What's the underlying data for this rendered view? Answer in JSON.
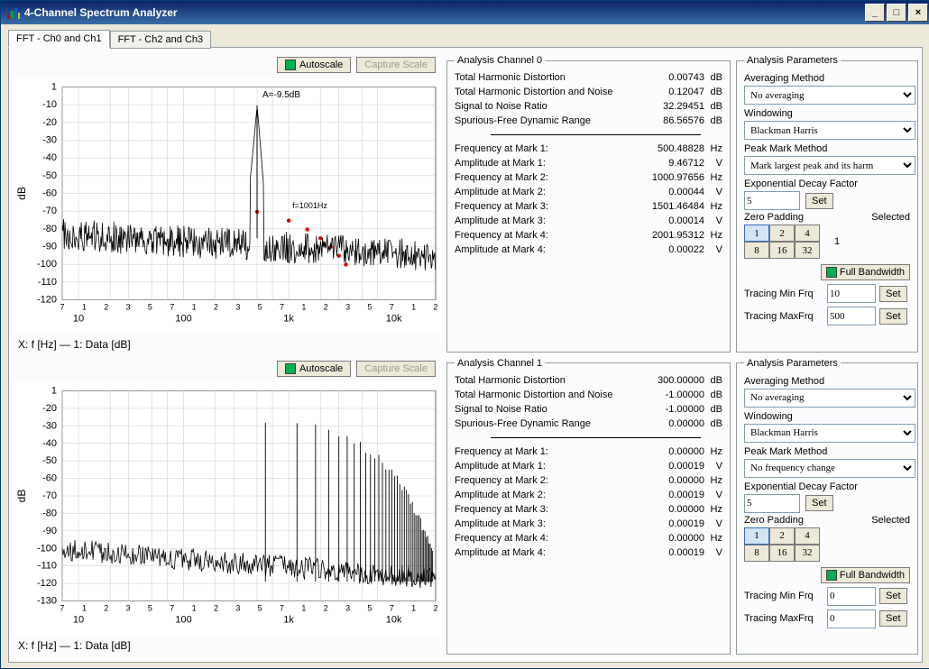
{
  "window": {
    "title": "4-Channel Spectrum Analyzer"
  },
  "tabs": {
    "t0": "FFT - Ch0 and Ch1",
    "t1": "FFT - Ch2 and Ch3"
  },
  "buttons": {
    "autoscale": "Autoscale",
    "capture": "Capture Scale",
    "set": "Set",
    "fullbw": "Full Bandwidth"
  },
  "chart0": {
    "ylabel": "dB",
    "peak_label": "A=-9.5dB",
    "mark_label": "f=1001Hz",
    "legend": "X: f [Hz] — 1: Data [dB]",
    "yticks": [
      "1",
      "-10",
      "-20",
      "-30",
      "-40",
      "-50",
      "-60",
      "-70",
      "-80",
      "-90",
      "-100",
      "-110",
      "-120"
    ],
    "xticks_minor": [
      "7",
      "1",
      "2",
      "3",
      "5",
      "7",
      "1",
      "2",
      "3",
      "5",
      "7",
      "1",
      "2",
      "3",
      "5",
      "7",
      "1",
      "2"
    ],
    "xticks_major": [
      "10",
      "100",
      "1k",
      "10k"
    ]
  },
  "chart1": {
    "ylabel": "dB",
    "legend": "X: f [Hz] — 1: Data [dB]",
    "yticks": [
      "1",
      "-20",
      "-30",
      "-40",
      "-50",
      "-60",
      "-70",
      "-80",
      "-90",
      "-100",
      "-110",
      "-120",
      "-130"
    ],
    "xticks_minor": [
      "7",
      "1",
      "2",
      "3",
      "5",
      "7",
      "1",
      "2",
      "3",
      "5",
      "7",
      "1",
      "2",
      "3",
      "5",
      "7",
      "1",
      "2"
    ],
    "xticks_major": [
      "10",
      "100",
      "1k",
      "10k"
    ]
  },
  "analysis0": {
    "title": "Analysis Channel 0",
    "rows": [
      {
        "l": "Total Harmonic Distortion",
        "v": "0.00743",
        "u": "dB"
      },
      {
        "l": "Total Harmonic Distortion and Noise",
        "v": "0.12047",
        "u": "dB"
      },
      {
        "l": "Signal to Noise Ratio",
        "v": "32.29451",
        "u": "dB"
      },
      {
        "l": "Spurious-Free Dynamic Range",
        "v": "86.56576",
        "u": "dB"
      }
    ],
    "marks": [
      {
        "l": "Frequency at Mark 1:",
        "v": "500.48828",
        "u": "Hz"
      },
      {
        "l": "Amplitude at Mark 1:",
        "v": "9.46712",
        "u": "V"
      },
      {
        "l": "Frequency at Mark 2:",
        "v": "1000.97656",
        "u": "Hz"
      },
      {
        "l": "Amplitude at Mark 2:",
        "v": "0.00044",
        "u": "V"
      },
      {
        "l": "Frequency at Mark 3:",
        "v": "1501.46484",
        "u": "Hz"
      },
      {
        "l": "Amplitude at Mark 3:",
        "v": "0.00014",
        "u": "V"
      },
      {
        "l": "Frequency at Mark 4:",
        "v": "2001.95312",
        "u": "Hz"
      },
      {
        "l": "Amplitude at Mark 4:",
        "v": "0.00022",
        "u": "V"
      }
    ]
  },
  "analysis1": {
    "title": "Analysis Channel 1",
    "rows": [
      {
        "l": "Total Harmonic Distortion",
        "v": "300.00000",
        "u": "dB"
      },
      {
        "l": "Total Harmonic Distortion and Noise",
        "v": "-1.00000",
        "u": "dB"
      },
      {
        "l": "Signal to Noise Ratio",
        "v": "-1.00000",
        "u": "dB"
      },
      {
        "l": "Spurious-Free Dynamic Range",
        "v": "0.00000",
        "u": "dB"
      }
    ],
    "marks": [
      {
        "l": "Frequency at Mark 1:",
        "v": "0.00000",
        "u": "Hz"
      },
      {
        "l": "Amplitude at Mark 1:",
        "v": "0.00019",
        "u": "V"
      },
      {
        "l": "Frequency at Mark 2:",
        "v": "0.00000",
        "u": "Hz"
      },
      {
        "l": "Amplitude at Mark 2:",
        "v": "0.00019",
        "u": "V"
      },
      {
        "l": "Frequency at Mark 3:",
        "v": "0.00000",
        "u": "Hz"
      },
      {
        "l": "Amplitude at Mark 3:",
        "v": "0.00019",
        "u": "V"
      },
      {
        "l": "Frequency at Mark 4:",
        "v": "0.00000",
        "u": "Hz"
      },
      {
        "l": "Amplitude at Mark 4:",
        "v": "0.00019",
        "u": "V"
      }
    ]
  },
  "params0": {
    "title": "Analysis Parameters",
    "avg_l": "Averaging Method",
    "avg_v": "No averaging",
    "win_l": "Windowing",
    "win_v": "Blackman Harris",
    "pm_l": "Peak Mark Method",
    "pm_v": "Mark largest peak and its harm",
    "edf_l": "Exponential Decay Factor",
    "edf_v": "5",
    "zp_l": "Zero Padding",
    "sel_l": "Selected",
    "sel_v": "1",
    "zp_opts": [
      "1",
      "2",
      "4",
      "8",
      "16",
      "32"
    ],
    "tmin_l": "Tracing Min Frq",
    "tmin_v": "10",
    "tmax_l": "Tracing MaxFrq",
    "tmax_v": "500"
  },
  "params1": {
    "title": "Analysis Parameters",
    "avg_l": "Averaging Method",
    "avg_v": "No averaging",
    "win_l": "Windowing",
    "win_v": "Blackman Harris",
    "pm_l": "Peak Mark Method",
    "pm_v": "No frequency change",
    "edf_l": "Exponential Decay Factor",
    "edf_v": "5",
    "zp_l": "Zero Padding",
    "sel_l": "Selected",
    "sel_v": "",
    "zp_opts": [
      "1",
      "2",
      "4",
      "8",
      "16",
      "32"
    ],
    "tmin_l": "Tracing Min Frq",
    "tmin_v": "0",
    "tmax_l": "Tracing MaxFrq",
    "tmax_v": "0"
  },
  "chart_data": [
    {
      "type": "line",
      "title": "FFT Ch0",
      "xlabel": "f [Hz]",
      "ylabel": "dB",
      "x_log": true,
      "xlim": [
        7,
        25000
      ],
      "ylim": [
        -120,
        1
      ],
      "series": [
        {
          "name": "Data",
          "description": "Broadband noise floor around -85 to -115 dB with a single fundamental peak at ~500 Hz reaching about -9.5 dB and harmonic markers at ~1001, 1501, 2002 Hz"
        }
      ]
    },
    {
      "type": "line",
      "title": "FFT Ch1",
      "xlabel": "f [Hz]",
      "ylabel": "dB",
      "x_log": true,
      "xlim": [
        7,
        25000
      ],
      "ylim": [
        -135,
        1
      ],
      "series": [
        {
          "name": "Data",
          "description": "Noise floor around -100 to -130 dB with many closely spaced harmonic spikes above ~600 Hz rising to about -15 to -30 dB"
        }
      ]
    }
  ]
}
